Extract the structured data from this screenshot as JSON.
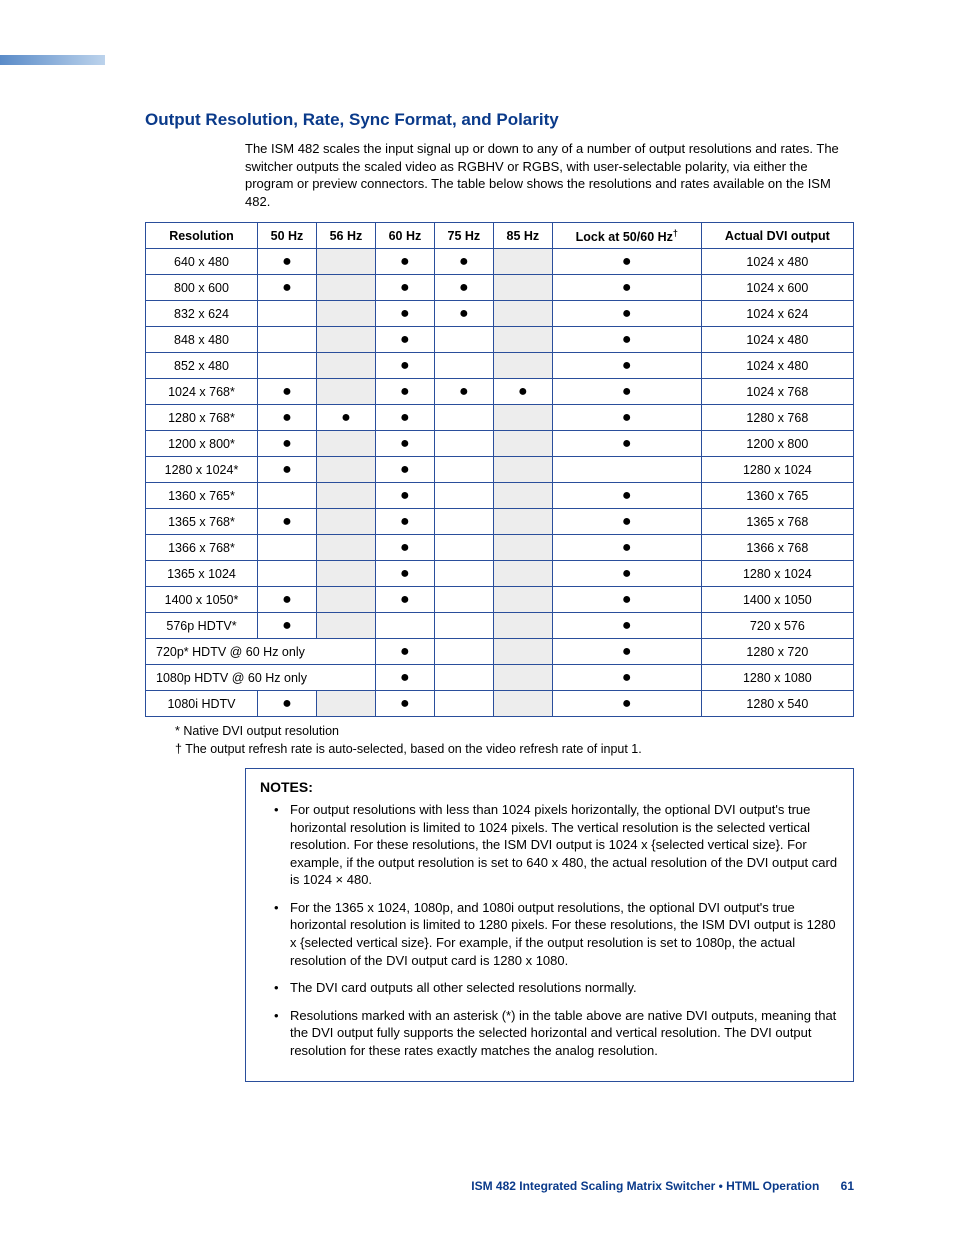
{
  "heading": "Output Resolution, Rate, Sync Format, and Polarity",
  "intro": "The ISM 482 scales the input signal up or down to any of a number of output resolutions and rates.  The switcher outputs the scaled video as RGBHV or RGBS, with user-selectable polarity, via either the program or preview connectors.  The table below shows the resolutions and rates available on the ISM 482.",
  "columns": [
    "Resolution",
    "50 Hz",
    "56 Hz",
    "60 Hz",
    "75 Hz",
    "85 Hz",
    "Lock at 50/60 Hz",
    "Actual DVI output"
  ],
  "lock_dagger": "†",
  "rows": [
    {
      "res": "640 x 480",
      "c": [
        true,
        null,
        true,
        true,
        null,
        true
      ],
      "dvi": "1024 x 480"
    },
    {
      "res": "800 x 600",
      "c": [
        true,
        null,
        true,
        true,
        null,
        true
      ],
      "dvi": "1024 x 600"
    },
    {
      "res": "832 x 624",
      "c": [
        false,
        null,
        true,
        true,
        null,
        true
      ],
      "dvi": "1024 x 624"
    },
    {
      "res": "848 x 480",
      "c": [
        false,
        null,
        true,
        false,
        null,
        true
      ],
      "dvi": "1024 x 480"
    },
    {
      "res": "852 x 480",
      "c": [
        false,
        null,
        true,
        false,
        null,
        true
      ],
      "dvi": "1024 x 480"
    },
    {
      "res": "1024 x 768*",
      "c": [
        true,
        null,
        true,
        true,
        true,
        true
      ],
      "dvi": "1024 x 768"
    },
    {
      "res": "1280 x 768*",
      "c": [
        true,
        true,
        true,
        false,
        null,
        true
      ],
      "dvi": "1280 x 768"
    },
    {
      "res": "1200 x 800*",
      "c": [
        true,
        null,
        true,
        false,
        null,
        true
      ],
      "dvi": "1200 x 800"
    },
    {
      "res": "1280 x 1024*",
      "c": [
        true,
        null,
        true,
        false,
        null,
        false
      ],
      "dvi": "1280 x 1024"
    },
    {
      "res": "1360 x 765*",
      "c": [
        false,
        null,
        true,
        false,
        null,
        true
      ],
      "dvi": "1360 x 765"
    },
    {
      "res": "1365 x 768*",
      "c": [
        true,
        null,
        true,
        false,
        null,
        true
      ],
      "dvi": "1365 x 768"
    },
    {
      "res": "1366 x 768*",
      "c": [
        false,
        null,
        true,
        false,
        null,
        true
      ],
      "dvi": "1366 x 768"
    },
    {
      "res": "1365 x 1024",
      "c": [
        false,
        null,
        true,
        false,
        null,
        true
      ],
      "dvi": "1280 x 1024"
    },
    {
      "res": "1400 x 1050*",
      "c": [
        true,
        null,
        true,
        false,
        null,
        true
      ],
      "dvi": "1400 x 1050"
    },
    {
      "res": "576p HDTV*",
      "c": [
        true,
        null,
        false,
        false,
        null,
        true
      ],
      "dvi": "720 x 576"
    }
  ],
  "span_rows": [
    {
      "label": "720p* HDTV @ 60 Hz only",
      "c": [
        true,
        false,
        null,
        true
      ],
      "dvi": "1280 x 720"
    },
    {
      "label": "1080p HDTV @ 60 Hz only",
      "c": [
        true,
        false,
        null,
        true
      ],
      "dvi": "1280 x 1080"
    }
  ],
  "last_row": {
    "res": "1080i HDTV",
    "c": [
      true,
      null,
      true,
      false,
      null,
      true
    ],
    "dvi": "1280 x 540"
  },
  "footnote_star": "* Native DVI output resolution",
  "footnote_dagger": "† The output refresh rate is auto-selected, based on the video refresh rate of input 1.",
  "notes_title": "NOTES:",
  "notes": [
    "For output resolutions with less than 1024 pixels horizontally, the optional DVI output's true horizontal resolution is limited to 1024 pixels. The vertical resolution is the selected vertical resolution. For these resolutions, the ISM DVI output is 1024 x {selected vertical size}. For example, if the output resolution is set to 640 x 480, the actual resolution of the DVI output card is 1024 × 480.",
    "For the 1365 x 1024, 1080p, and 1080i output resolutions, the optional DVI output's true horizontal resolution is limited to 1280 pixels. For these resolutions, the ISM DVI output is 1280 x {selected vertical size}. For example, if the output resolution is set to 1080p, the actual resolution of the DVI output card is 1280 x 1080.",
    "The DVI card outputs all other selected resolutions normally.",
    "Resolutions marked with an asterisk (*) in the table above are native DVI outputs, meaning that the DVI output fully supports the selected horizontal and vertical resolution. The DVI output resolution for these rates exactly matches the analog resolution."
  ],
  "footer_product": "ISM 482 Integrated Scaling Matrix Switcher • HTML Operation",
  "footer_page": "61"
}
